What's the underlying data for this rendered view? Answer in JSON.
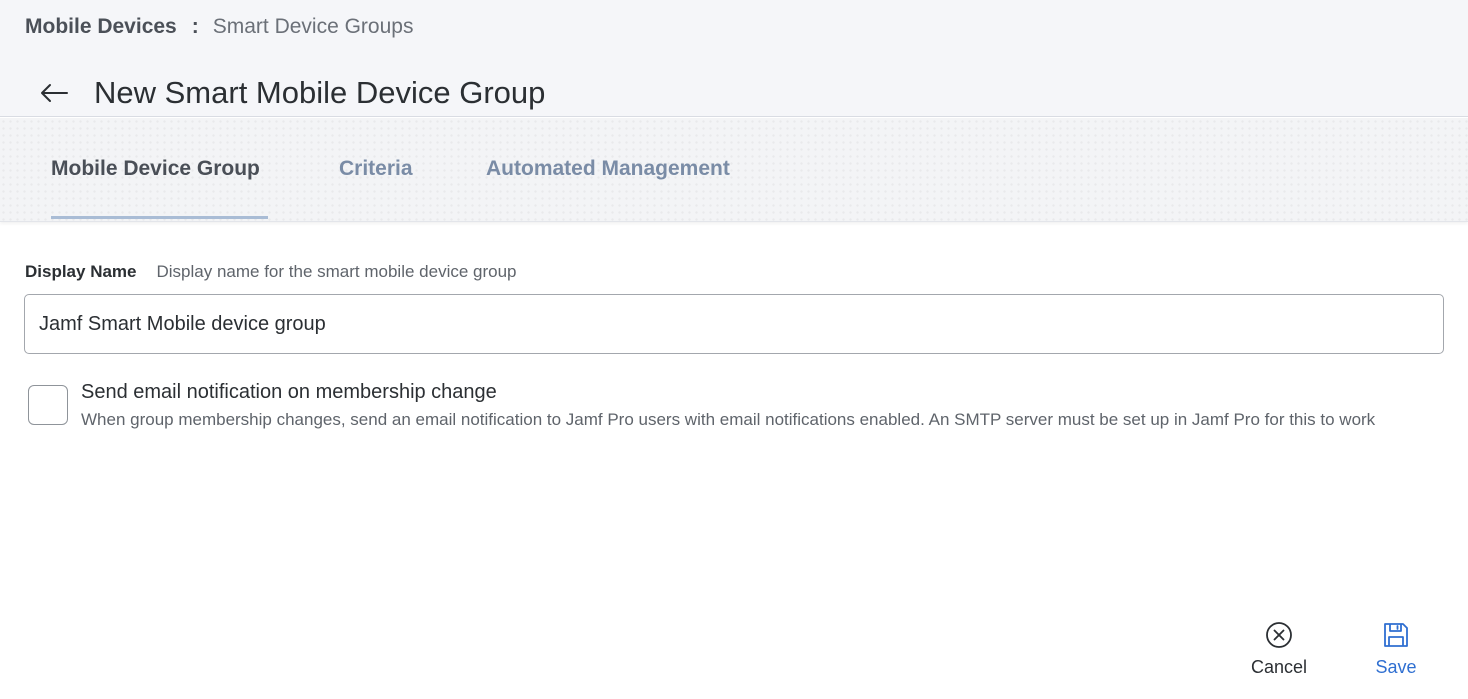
{
  "breadcrumb": {
    "parent": "Mobile Devices",
    "separator": ":",
    "current": "Smart Device Groups"
  },
  "header": {
    "title": "New Smart Mobile Device Group",
    "back_icon": "arrow-left-icon"
  },
  "tabs": [
    {
      "label": "Mobile Device Group",
      "active": true
    },
    {
      "label": "Criteria",
      "active": false
    },
    {
      "label": "Automated Management",
      "active": false
    }
  ],
  "form": {
    "display_name": {
      "label": "Display Name",
      "hint": "Display name for the smart mobile device group",
      "value": "Jamf Smart Mobile device group"
    },
    "email_notification": {
      "checked": false,
      "label": "Send email notification on membership change",
      "description": "When group membership changes, send an email notification to Jamf Pro users with email notifications enabled. An SMTP server must be set up in Jamf Pro for this to work"
    }
  },
  "actions": {
    "cancel": {
      "label": "Cancel",
      "icon": "close-circle-icon"
    },
    "save": {
      "label": "Save",
      "icon": "floppy-disk-icon",
      "color": "#2f6fd1"
    }
  },
  "colors": {
    "accent": "#2f6fd1",
    "tab_inactive": "#7a8ca6",
    "tab_underline": "#a9bcd5"
  }
}
